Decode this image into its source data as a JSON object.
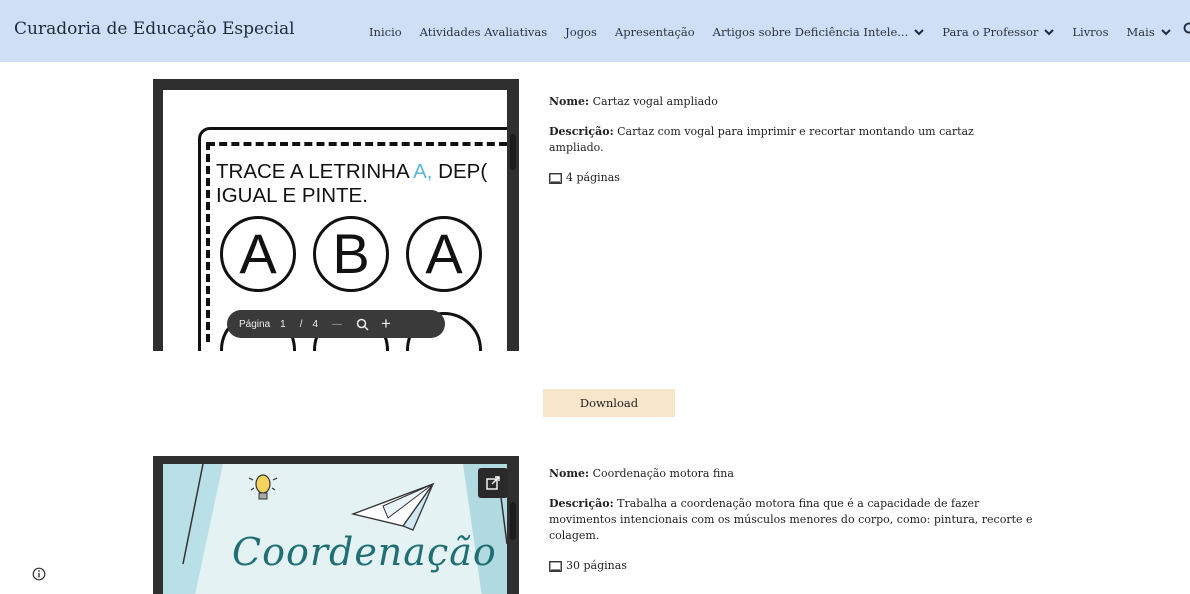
{
  "site": {
    "title": "Curadoria de Educação Especial"
  },
  "nav": {
    "items": [
      {
        "label": "Inicio",
        "has_dropdown": false
      },
      {
        "label": "Atividades Avaliativas",
        "has_dropdown": false
      },
      {
        "label": "Jogos",
        "has_dropdown": false
      },
      {
        "label": "Apresentação",
        "has_dropdown": false
      },
      {
        "label": "Artigos sobre Deficiência Intele...",
        "has_dropdown": true
      },
      {
        "label": "Para o Professor",
        "has_dropdown": true
      },
      {
        "label": "Livros",
        "has_dropdown": false
      },
      {
        "label": "Mais",
        "has_dropdown": true
      }
    ],
    "search_icon": "search-icon"
  },
  "items": [
    {
      "name_label": "Nome:",
      "name": "Cartaz vogal ampliado",
      "description_label": "Descrição:",
      "description": "Cartaz com vogal para imprimir e recortar montando um cartaz ampliado.",
      "pages": "4 páginas",
      "viewer": {
        "text_line1_pre": "TRACE A LETRINHA ",
        "text_line1_highlight": "A,",
        "text_line1_post": " DEP(",
        "text_line2": "IGUAL E PINTE.",
        "letters": [
          "A",
          "B",
          "A"
        ],
        "toolbar": {
          "page_label": "Página",
          "current_page": "1",
          "separator": "/",
          "total_pages": "4",
          "zoom_out": "—",
          "zoom_in": "+"
        }
      },
      "download_label": "Download"
    },
    {
      "name_label": "Nome:",
      "name": "Coordenação motora fina",
      "description_label": "Descrição:",
      "description": "Trabalha a  coordenação motora fina que é a capacidade de fazer movimentos intencionais com os músculos menores do corpo, como: pintura, recorte e colagem.",
      "pages": "30 páginas",
      "viewer": {
        "cover_title": "Coordenação"
      }
    }
  ],
  "colors": {
    "nav_bg": "#cfdff5",
    "download_bg": "#f5e6cc",
    "viewer_bg": "#2f2f2f",
    "highlight_blue": "#5ab7d9"
  }
}
